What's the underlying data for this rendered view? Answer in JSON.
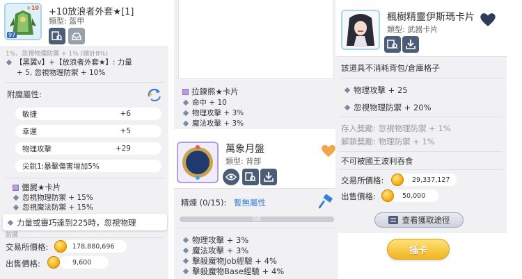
{
  "left": {
    "item_name": "+10放浪者外套★[1]",
    "item_type": "類型: 盔甲",
    "thumb_badge": "+10",
    "thumb_level": "97",
    "clip_line": "1%、忽視物理防禦 + 1% (總計8%)",
    "set_bonus_line1": "【黑翼v】+【放浪者外套★】: 力量",
    "set_bonus_line2": "+ 5, 忽視物理防禦 + 10%",
    "enchant_title": "附魔屬性:",
    "enchants": [
      {
        "label": "敏捷",
        "value": "+6"
      },
      {
        "label": "幸運",
        "value": "+5"
      },
      {
        "label": "物理攻擊",
        "value": "+29"
      },
      {
        "label": "尖銳1:暴擊傷害增加5%",
        "value": ""
      }
    ],
    "card_title": "僵屍★卡片",
    "card_lines": [
      "忽視物理防禦 + 15%",
      "忽視魔法防禦 + 15%"
    ],
    "tooltip_text": "力量或靈巧達到225時，忽視物理",
    "tooltip_under": "防禦",
    "trade_label": "交易所價格:",
    "trade_value": "178,880,696",
    "sell_label": "出售價格:",
    "sell_value": "9,600"
  },
  "middle_top": {
    "card_title": "拉鍊熊★卡片",
    "lines": [
      "命中 + 10",
      "物理攻擊 + 3%",
      "魔法攻擊 + 3%"
    ]
  },
  "middle": {
    "item_name": "萬象月盤",
    "item_type": "類型: 背部",
    "refine_label": "精煉 (0/15):",
    "refine_value": "暫無屬性",
    "progress_text": "0/0",
    "progress_fraction": 0,
    "lines": [
      "物理攻擊 + 3%",
      "魔法攻擊 + 3%",
      "擊殺魔物Job經驗 + 4%",
      "擊殺魔物Base經驗 + 4%"
    ]
  },
  "right": {
    "item_name": "楓樹精靈伊斯瑪卡片",
    "item_type": "類型: 武器卡片",
    "note": "該道具不消耗背包/倉庫格子",
    "stats": [
      "物理攻擊 + 25",
      "忽視物理防禦 + 20%"
    ],
    "deposit_label": "存入獎勵:",
    "deposit_value": "忽視物理防禦 + 1%",
    "unlock_label": "解鎖獎勵:",
    "unlock_value": "物理防禦 + 1%",
    "poring_note": "不可被國王波利吞食",
    "trade_label": "交易所價格:",
    "trade_value": "29,337,127",
    "sell_label": "出售價格:",
    "sell_value": "50,000",
    "source_button": "查看獲取途徑",
    "insert_button": "插卡"
  },
  "colors": {
    "accent_blue": "#3b7fd6",
    "heart_orange": "#f4a54a",
    "heart_navy": "#2f3d58",
    "gold_button": "#f6c533"
  }
}
